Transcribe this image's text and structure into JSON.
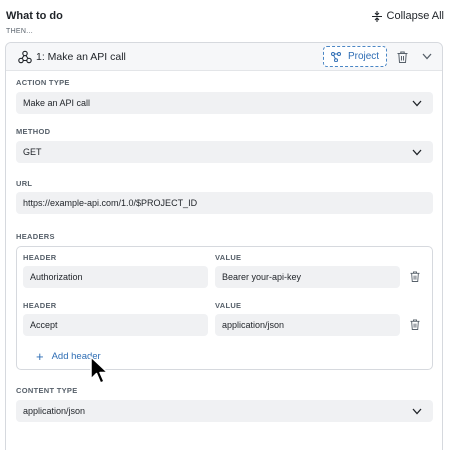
{
  "header": {
    "section_title": "What to do",
    "collapse_all_label": "Collapse All",
    "then_label": "THEN..."
  },
  "action": {
    "title": "1: Make an API call",
    "project_badge": "Project",
    "action_type": {
      "label": "ACTION TYPE",
      "value": "Make an API call"
    },
    "method": {
      "label": "METHOD",
      "value": "GET"
    },
    "url": {
      "label": "URL",
      "value": "https://example-api.com/1.0/$PROJECT_ID"
    },
    "headers": {
      "label": "HEADERS",
      "rows": [
        {
          "header_label": "HEADER",
          "header_value": "Authorization",
          "value_label": "VALUE",
          "value_value": "Bearer your-api-key"
        },
        {
          "header_label": "HEADER",
          "header_value": "Accept",
          "value_label": "VALUE",
          "value_value": "application/json"
        }
      ],
      "add_label": "Add header"
    },
    "content_type": {
      "label": "CONTENT TYPE",
      "value": "application/json"
    }
  },
  "icons": {
    "collapse": "collapse-icon",
    "webhook": "webhook-icon",
    "project": "branch-icon",
    "trash": "trash-icon",
    "chevron": "chevron-down-icon",
    "plus": "plus-icon",
    "cursor": "mouse-cursor"
  },
  "colors": {
    "accent": "#2e6db4",
    "field_bg": "#f0f1f3",
    "header_bg": "#f6f7f9",
    "border": "#d6d9de"
  }
}
